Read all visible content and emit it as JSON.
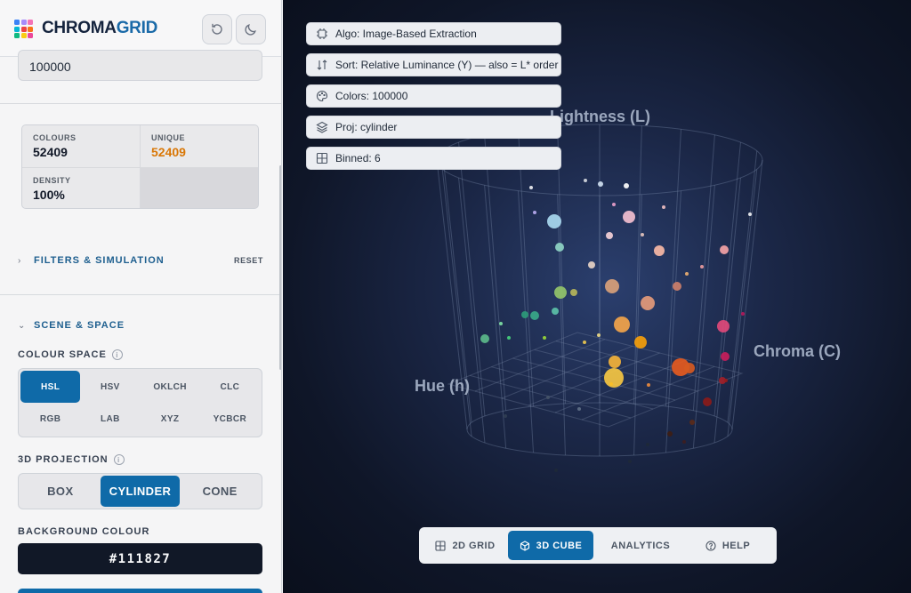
{
  "app": {
    "brand_a": "CHROMA",
    "brand_b": "GRID"
  },
  "header": {
    "reset_icon": "reset-icon",
    "theme_icon": "moon-icon"
  },
  "seed": {
    "value": "100000"
  },
  "stats": {
    "colours_label": "COLOURS",
    "colours_value": "52409",
    "unique_label": "UNIQUE",
    "unique_value": "52409",
    "density_label": "DENSITY",
    "density_value": "100%"
  },
  "filters": {
    "title": "FILTERS & SIMULATION",
    "reset": "RESET"
  },
  "scene": {
    "title": "SCENE & SPACE"
  },
  "colour_space": {
    "label": "COLOUR SPACE",
    "options": [
      "HSL",
      "HSV",
      "OKLCH",
      "CLC",
      "RGB",
      "LAB",
      "XYZ",
      "YCBCR"
    ],
    "selected": "HSL"
  },
  "projection": {
    "label": "3D PROJECTION",
    "options": [
      "BOX",
      "CYLINDER",
      "CONE"
    ],
    "selected": "CYLINDER"
  },
  "background": {
    "label": "BACKGROUND COLOUR",
    "value": "#111827"
  },
  "chips": [
    {
      "icon": "chip-icon",
      "text": "Algo: Image-Based Extraction"
    },
    {
      "icon": "sort-icon",
      "text": "Sort: Relative Luminance (Y) — also = L* order"
    },
    {
      "icon": "palette-icon",
      "text": "Colors: 100000"
    },
    {
      "icon": "layers-icon",
      "text": "Proj: cylinder"
    },
    {
      "icon": "grid-icon",
      "text": "Binned: 6"
    }
  ],
  "axes": {
    "lightness": "Lightness (L)",
    "chroma": "Chroma (C)",
    "hue": "Hue (h)"
  },
  "tabs": [
    {
      "icon": "grid-icon",
      "label": "2D GRID"
    },
    {
      "icon": "cube-icon",
      "label": "3D CUBE"
    },
    {
      "icon": "",
      "label": "ANALYTICS"
    },
    {
      "icon": "help-icon",
      "label": "HELP"
    }
  ],
  "active_tab": "3D CUBE",
  "colors": {
    "accent": "#0f6aa8",
    "orange": "#d97706",
    "background": "#111827"
  },
  "points": [
    {
      "c": "#a9d8ef"
    },
    {
      "c": "#f3bfd0"
    },
    {
      "c": "#f7b8a6"
    },
    {
      "c": "#f4a3a6"
    },
    {
      "c": "#8ed4c4"
    },
    {
      "c": "#5bb88a"
    },
    {
      "c": "#d8a07a"
    },
    {
      "c": "#e39a7a"
    },
    {
      "c": "#f2a44a"
    },
    {
      "c": "#f5c542"
    },
    {
      "c": "#f4b23a"
    },
    {
      "c": "#f59e0b"
    },
    {
      "c": "#e45a20"
    },
    {
      "c": "#d65a22"
    },
    {
      "c": "#e0497a"
    },
    {
      "c": "#c81e5b"
    },
    {
      "c": "#3aa889"
    },
    {
      "c": "#2e9a7a"
    },
    {
      "c": "#5bc0a8"
    },
    {
      "c": "#92c46a"
    },
    {
      "c": "#b5b55a"
    },
    {
      "c": "#cc7f6a"
    },
    {
      "c": "#a02029"
    },
    {
      "c": "#8b1a1a"
    },
    {
      "c": "#5a2a1a"
    },
    {
      "c": "#3d1d14"
    },
    {
      "c": "#f5d1d8"
    },
    {
      "c": "#e7d4c6"
    },
    {
      "c": "#ffffff"
    },
    {
      "c": "#cfe0f0"
    }
  ]
}
